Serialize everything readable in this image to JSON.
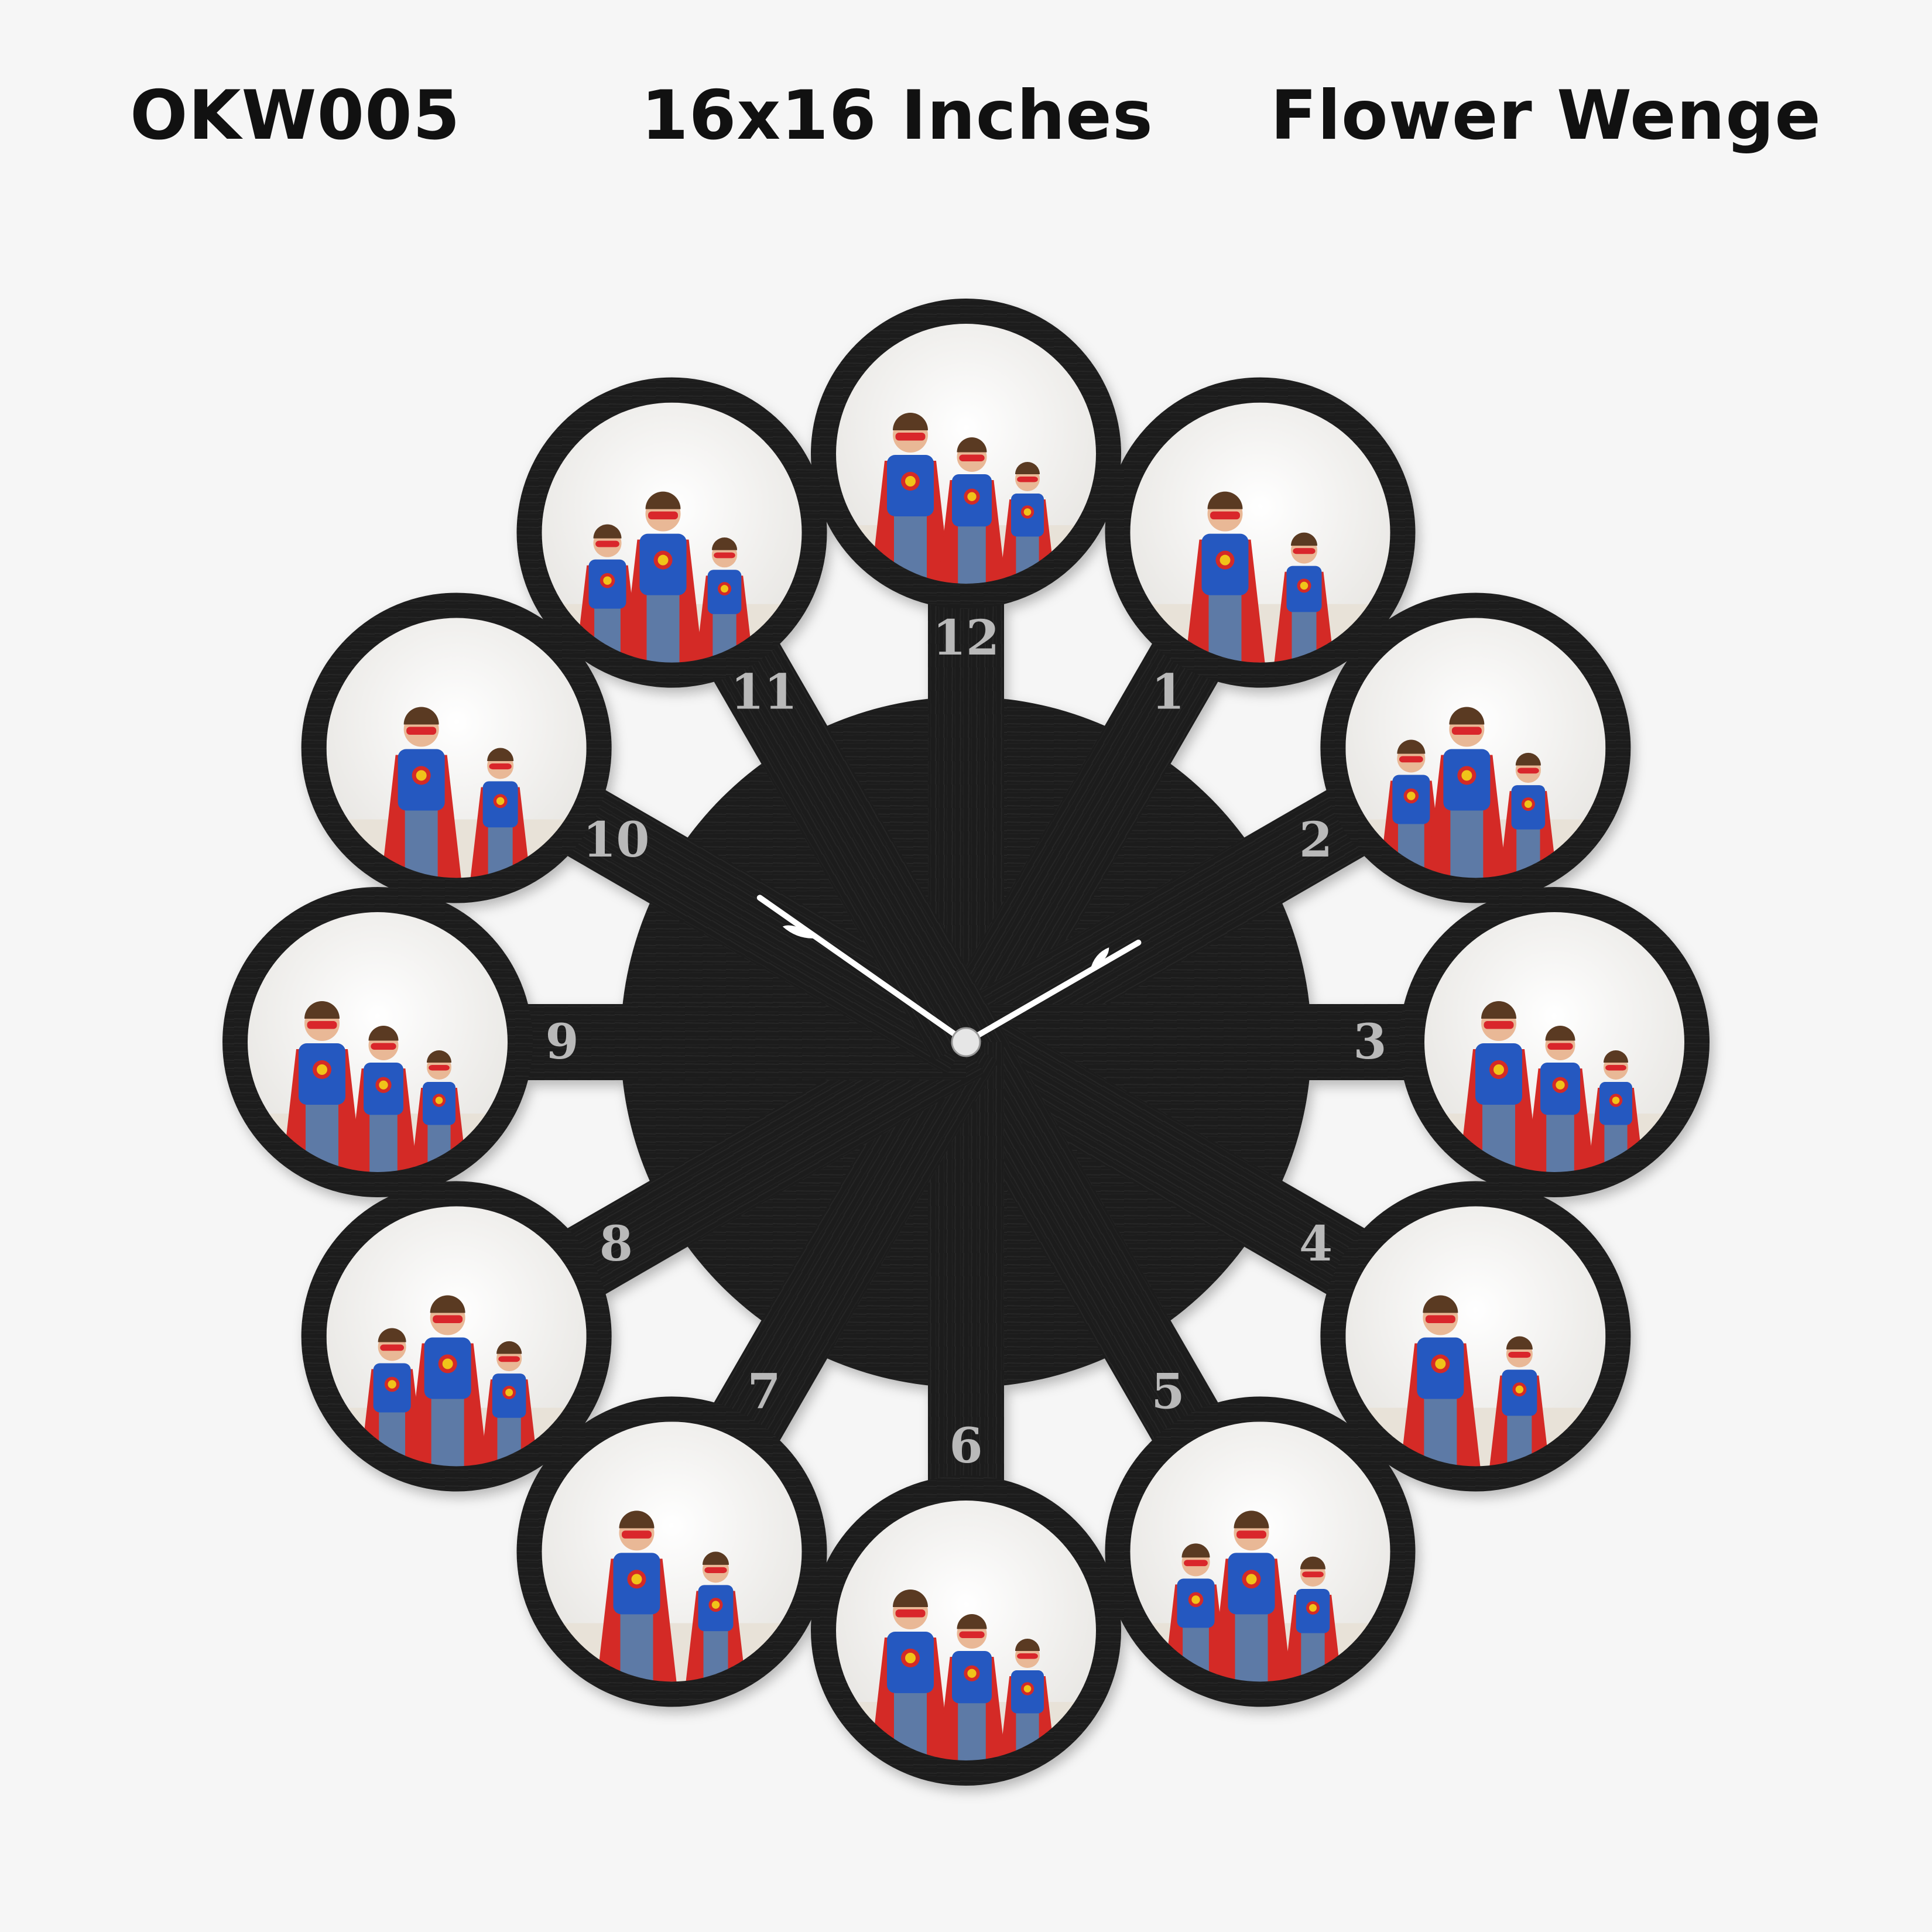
{
  "header": {
    "product_code": "OKW005",
    "size": "16x16 Inches",
    "design_name": "Flower Wenge"
  },
  "clock": {
    "numerals": [
      "12",
      "1",
      "2",
      "3",
      "4",
      "5",
      "6",
      "7",
      "8",
      "9",
      "10",
      "11"
    ],
    "photo_count": 12,
    "photo_subject": "family in superhero costumes",
    "hands_time": "10:10",
    "colors": {
      "background": "#f6f6f6",
      "wood": "#1b1b1b",
      "wood_grain": "#2a2a2a",
      "numeral": "#b9b9b9",
      "hands": "#ffffff",
      "shirt": "#2558c0",
      "cape": "#d42a26",
      "star": "#f0c419",
      "mask": "#d9262b",
      "text": "#111111"
    }
  }
}
